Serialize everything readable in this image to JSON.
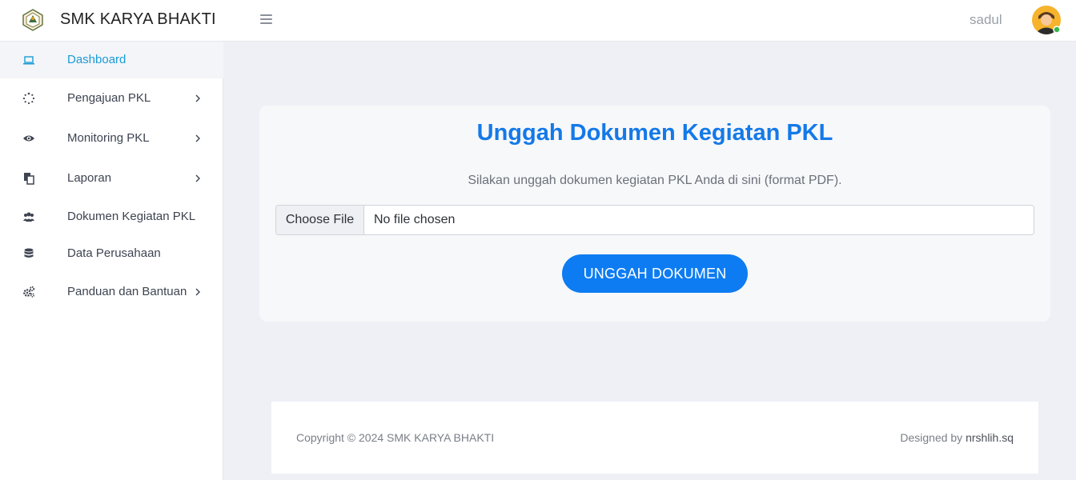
{
  "header": {
    "brand": "SMK KARYA BHAKTI",
    "username": "sadul",
    "online_color": "#3bb54a"
  },
  "sidebar": {
    "items": [
      {
        "label": "Dashboard",
        "icon": "laptop-icon",
        "active": true,
        "has_chevron": false
      },
      {
        "label": "Pengajuan PKL",
        "icon": "spinner-icon",
        "active": false,
        "has_chevron": true
      },
      {
        "label": "Monitoring PKL",
        "icon": "eye-icon",
        "active": false,
        "has_chevron": true
      },
      {
        "label": "Laporan",
        "icon": "copy-icon",
        "active": false,
        "has_chevron": true
      },
      {
        "label": "Dokumen Kegiatan PKL",
        "icon": "users-icon",
        "active": false,
        "has_chevron": false
      },
      {
        "label": "Data Perusahaan",
        "icon": "database-icon",
        "active": false,
        "has_chevron": false
      },
      {
        "label": "Panduan dan Bantuan",
        "icon": "cogs-icon",
        "active": false,
        "has_chevron": true
      }
    ]
  },
  "main": {
    "title": "Unggah Dokumen Kegiatan PKL",
    "subtitle": "Silakan unggah dokumen kegiatan PKL Anda di sini (format PDF).",
    "file_button_label": "Choose File",
    "file_status": "No file chosen",
    "upload_button_label": "UNGGAH DOKUMEN",
    "accent_color": "#1479e8"
  },
  "footer": {
    "copyright": "Copyright © 2024 SMK KARYA BHAKTI",
    "designed_prefix": "Designed by",
    "designer": "nrshlih.sq"
  }
}
